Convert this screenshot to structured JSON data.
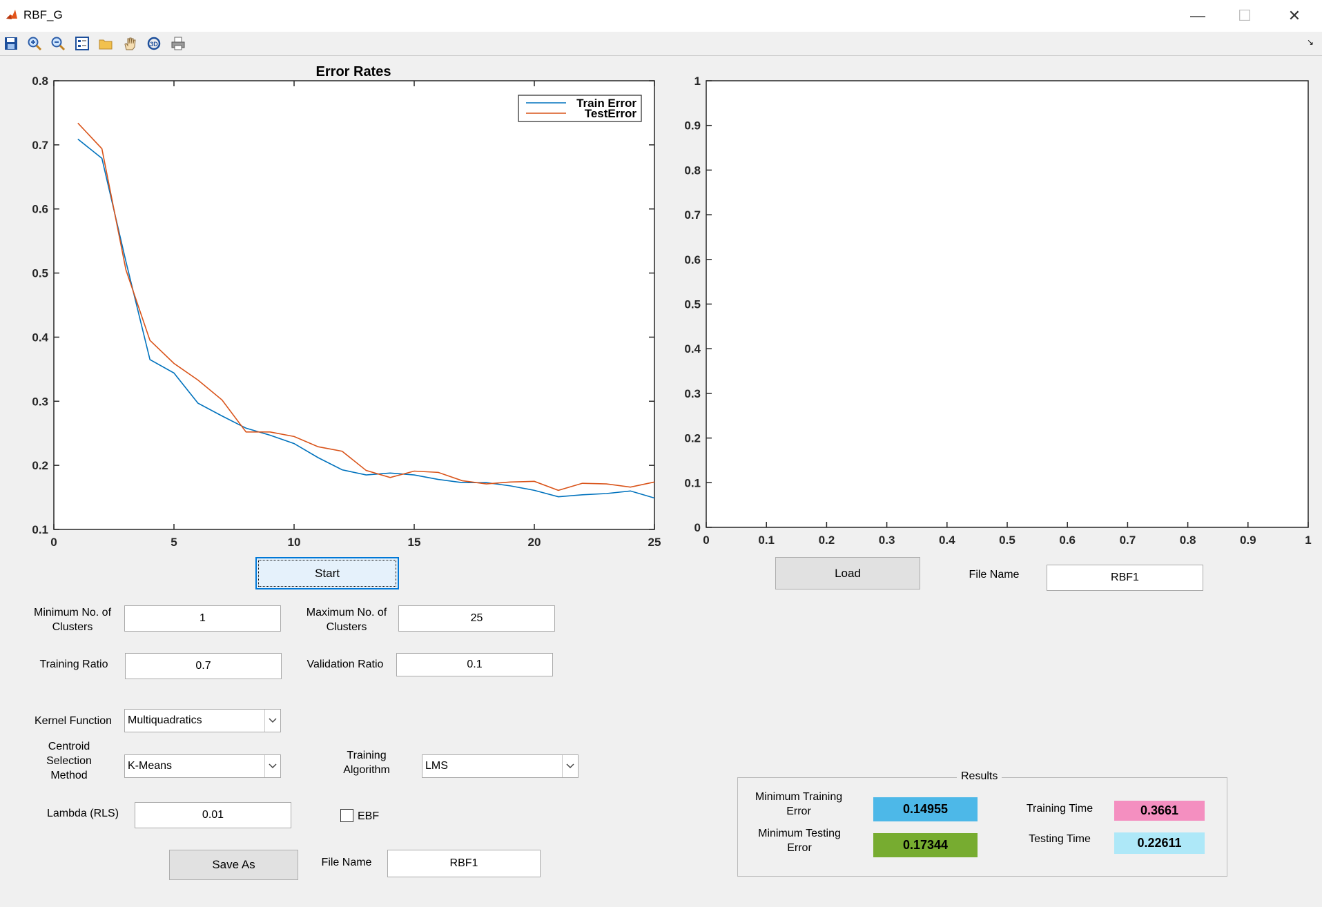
{
  "window": {
    "title": "RBF_G"
  },
  "toolbar": {
    "icons": [
      "save-icon",
      "zoom-in-icon",
      "zoom-out-icon",
      "insert-legend-icon",
      "open-folder-icon",
      "pan-hand-icon",
      "rotate-3d-icon",
      "print-icon"
    ]
  },
  "chart_data": [
    {
      "type": "line",
      "title": "Error Rates",
      "xlabel": "",
      "ylabel": "",
      "xlim": [
        0,
        25
      ],
      "ylim": [
        0.1,
        0.8
      ],
      "xticks": [
        0,
        5,
        10,
        15,
        20,
        25
      ],
      "yticks": [
        0.1,
        0.2,
        0.3,
        0.4,
        0.5,
        0.6,
        0.7,
        0.8
      ],
      "legend": "top-right",
      "grid": false,
      "x": [
        1,
        2,
        3,
        4,
        5,
        6,
        7,
        8,
        9,
        10,
        11,
        12,
        13,
        14,
        15,
        16,
        17,
        18,
        19,
        20,
        21,
        22,
        23,
        24,
        25
      ],
      "series": [
        {
          "name": "Train Error",
          "color": "#0072bd",
          "values": [
            0.709,
            0.679,
            0.518,
            0.365,
            0.344,
            0.297,
            0.277,
            0.258,
            0.247,
            0.234,
            0.212,
            0.193,
            0.185,
            0.188,
            0.185,
            0.178,
            0.173,
            0.173,
            0.168,
            0.161,
            0.151,
            0.154,
            0.156,
            0.16,
            0.149
          ]
        },
        {
          "name": "TestError",
          "color": "#d95319",
          "values": [
            0.734,
            0.694,
            0.505,
            0.395,
            0.359,
            0.333,
            0.302,
            0.252,
            0.252,
            0.245,
            0.229,
            0.222,
            0.192,
            0.181,
            0.191,
            0.189,
            0.176,
            0.171,
            0.174,
            0.175,
            0.161,
            0.172,
            0.171,
            0.166,
            0.174
          ]
        }
      ]
    },
    {
      "type": "line",
      "title": "",
      "xlim": [
        0,
        1
      ],
      "ylim": [
        0,
        1
      ],
      "xticks": [
        0,
        0.1,
        0.2,
        0.3,
        0.4,
        0.5,
        0.6,
        0.7,
        0.8,
        0.9,
        1
      ],
      "yticks": [
        0,
        0.1,
        0.2,
        0.3,
        0.4,
        0.5,
        0.6,
        0.7,
        0.8,
        0.9,
        1
      ],
      "grid": false,
      "series": []
    }
  ],
  "controls": {
    "start_label": "Start",
    "load_label": "Load",
    "save_as_label": "Save As",
    "min_clusters_label": "Minimum No. of Clusters",
    "min_clusters_value": "1",
    "max_clusters_label": "Maximum No. of Clusters",
    "max_clusters_value": "25",
    "training_ratio_label": "Training Ratio",
    "training_ratio_value": "0.7",
    "validation_ratio_label": "Validation Ratio",
    "validation_ratio_value": "0.1",
    "kernel_label": "Kernel Function",
    "kernel_value": "Multiquadratics",
    "centroid_label": "Centroid Selection Method",
    "centroid_value": "K-Means",
    "training_algo_label": "Training Algorithm",
    "training_algo_value": "LMS",
    "lambda_label": "Lambda (RLS)",
    "lambda_value": "0.01",
    "ebf_label": "EBF",
    "ebf_checked": false,
    "save_file_label": "File Name",
    "save_file_value": "RBF1",
    "load_file_label": "File Name",
    "load_file_value": "RBF1"
  },
  "results": {
    "title": "Results",
    "min_train_label": "Minimum Training Error",
    "min_train_value": "0.14955",
    "min_train_color": "#4db8e8",
    "min_test_label": "Minimum  Testing Error",
    "min_test_value": "0.17344",
    "min_test_color": "#77ac30",
    "train_time_label": "Training Time",
    "train_time_value": "0.3661",
    "train_time_color": "#f48fc0",
    "test_time_label": "Testing Time",
    "test_time_value": "0.22611",
    "test_time_color": "#aee8f8"
  }
}
